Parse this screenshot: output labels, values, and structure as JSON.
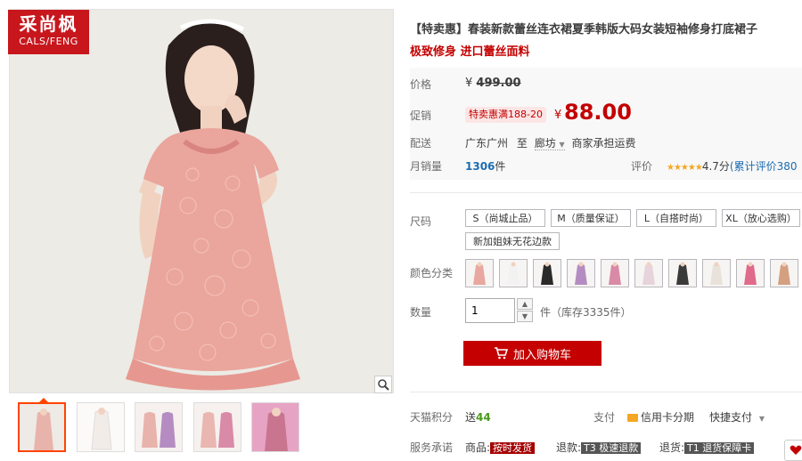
{
  "brand": {
    "name_cn": "采尚枫",
    "name_en": "CALS/FENG"
  },
  "product": {
    "title": "【特卖惠】春装新款蕾丝连衣裙夏季韩版大码女装短袖修身打底裙子",
    "subtitle": "极致修身 进口蕾丝面料"
  },
  "price": {
    "label": "价格",
    "currency": "¥",
    "original": "499.00",
    "promo_label": "促销",
    "promo_badge": "特卖惠满188-20",
    "promo": "88.00"
  },
  "shipping": {
    "label": "配送",
    "from": "广东广州",
    "to_word": "至",
    "destination": "廊坊",
    "fee_text": "商家承担运费"
  },
  "sales": {
    "label": "月销量",
    "count": "1306",
    "unit": "件"
  },
  "rating": {
    "label": "评价",
    "score": "4.7分",
    "comment": "(累计评价380"
  },
  "size": {
    "label": "尺码",
    "options": [
      "S（尚城止品）",
      "M（质量保证）",
      "L（自搭时尚）",
      "XL（放心选购）",
      "新加姐妹无花边款"
    ]
  },
  "color": {
    "label": "颜色分类",
    "swatches": [
      "#e8a7a0",
      "#f2f2f2",
      "#2a2a2a",
      "#b58cc2",
      "#d98aa6",
      "#e7d3dc",
      "#3a3a3a",
      "#e9e2da",
      "#e06a8a",
      "#d4a080"
    ]
  },
  "quantity": {
    "label": "数量",
    "value": "1",
    "stock": "件（库存3335件）"
  },
  "cart": {
    "label": "加入购物车"
  },
  "tmall_points": {
    "label": "天猫积分",
    "value_prefix": "送",
    "value": "44"
  },
  "payment": {
    "label": "支付",
    "credit_card": "信用卡分期",
    "quick": "快捷支付"
  },
  "service": {
    "label": "服务承诺",
    "items": [
      {
        "prefix": "商品:",
        "tag": "按时发货"
      },
      {
        "prefix": "退款:",
        "tag": "T3 极速退款"
      },
      {
        "prefix": "退货:",
        "tag": "T1 退货保障卡"
      }
    ]
  },
  "thumbnail_colors": [
    "#e8b3ab",
    "#f2ece8",
    "#d9a8b0",
    "#e9b6b0",
    "#d98aa6"
  ]
}
